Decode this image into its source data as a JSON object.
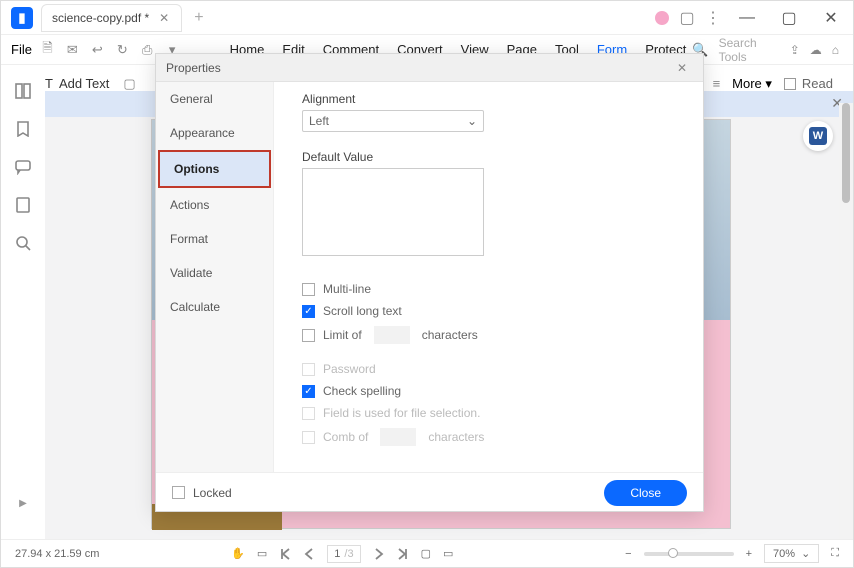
{
  "titlebar": {
    "doc_name": "science-copy.pdf *"
  },
  "menu": {
    "file": "File",
    "items": [
      "Home",
      "Edit",
      "Comment",
      "Convert",
      "View",
      "Page",
      "Tool",
      "Form",
      "Protect"
    ],
    "active_index": 7,
    "search_placeholder": "Search Tools"
  },
  "toolbar": {
    "add_text": "Add Text",
    "more": "More",
    "read": "Read"
  },
  "dialog": {
    "title": "Properties",
    "side": [
      "General",
      "Appearance",
      "Options",
      "Actions",
      "Format",
      "Validate",
      "Calculate"
    ],
    "selected_index": 2,
    "alignment_label": "Alignment",
    "alignment_value": "Left",
    "default_value_label": "Default Value",
    "cb_multiline": "Multi-line",
    "cb_scroll": "Scroll long text",
    "cb_limit_pre": "Limit of",
    "cb_limit_post": "characters",
    "cb_password": "Password",
    "cb_spell": "Check spelling",
    "cb_filesel": "Field is used for file selection.",
    "cb_comb_pre": "Comb of",
    "cb_comb_post": "characters",
    "locked": "Locked",
    "close": "Close"
  },
  "status": {
    "dims": "27.94 x 21.59 cm",
    "page_cur": "1",
    "page_total": "/3",
    "zoom": "70%"
  },
  "word_badge": "W"
}
